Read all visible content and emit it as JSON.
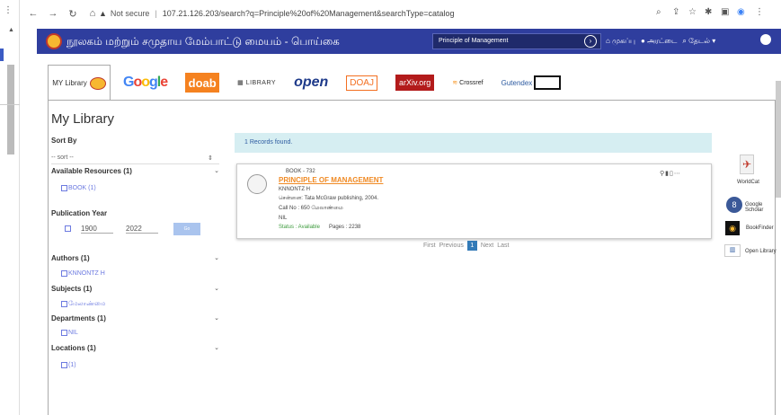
{
  "browser": {
    "security_label": "Not secure",
    "url": "107.21.126.203/search?q=Principle%20of%20Management&searchType=catalog"
  },
  "site": {
    "title": "நூலகம் மற்றும் சமுதாய மேம்பாட்டு மையம் - பொய்கை",
    "search_value": "Principle of Management",
    "nav_home": "முகப்பு",
    "nav_chat": "அரட்டை",
    "nav_search": "தேடல்"
  },
  "tabs": {
    "mylibrary": "MY Library",
    "doab": "doab",
    "archive": "LIBRARY",
    "open": "open",
    "doaj": "DOAJ",
    "arxiv": "arXiv.org",
    "crossref": "Crossref",
    "gutendex": "Gutendex"
  },
  "page": {
    "title": "My Library"
  },
  "sidebar": {
    "sort_by": "Sort By",
    "sort_value": "-- sort --",
    "available": "Available Resources (1)",
    "available_opt": "BOOK (1)",
    "pub_year": "Publication Year",
    "year_from": "1900",
    "year_to": "2022",
    "go": "Go",
    "authors": "Authors (1)",
    "authors_opt": "KNNONTZ H",
    "subjects": "Subjects (1)",
    "subjects_opt": "மேலாண்மை",
    "departments": "Departments (1)",
    "departments_opt": "NIL",
    "locations": "Locations (1)",
    "locations_opt": "(1)"
  },
  "results": {
    "records_found": "1 Records found.",
    "item": {
      "id": "BOOK - 732",
      "title": "PRINCIPLE OF MANAGEMENT",
      "author": "KNNONTZ H",
      "publisher": "சென்னை: Tata McGraw publishing, 2004.",
      "call_no": "Call No : 650 மேலாண்மை",
      "dept": "NIL",
      "status": "Status : Available",
      "pages": "Pages : 2238"
    },
    "pager": {
      "first": "First",
      "prev": "Previous",
      "current": "1",
      "next": "Next",
      "last": "Last"
    }
  },
  "right_links": {
    "worldcat": "WorldCat",
    "scholar": "Google Scholar",
    "bookfinder": "BookFinder",
    "openlib": "Open Library"
  }
}
